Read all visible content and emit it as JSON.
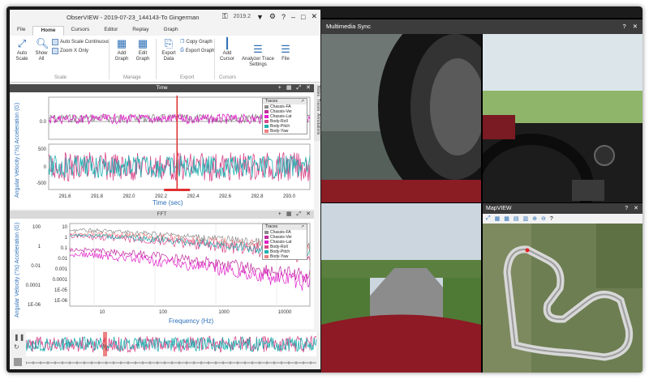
{
  "app": {
    "title": "ObserVIEW - 2019-07-23_144143-To Gingerman",
    "version": "2019.2",
    "menu_tabs": [
      "File",
      "Home",
      "Cursors",
      "Editor",
      "Replay",
      "Graph"
    ],
    "active_tab": "Home"
  },
  "ribbon": {
    "auto_scale": "Auto Scale",
    "show_all": "Show All",
    "auto_scale_continuous": "Auto Scale Continuous",
    "zoom_x_only": "Zoom X Only",
    "add_graph": "Add Graph",
    "edit_graph": "Edit Graph",
    "export_data": "Export Data",
    "copy_graph": "Copy Graph",
    "export_graph": "Export Graph",
    "add_cursor": "Add Cursor",
    "analyzer_trace_settings": "Analyzer Trace Settings",
    "file": "File",
    "groups": {
      "scale": "Scale",
      "manage": "Manage",
      "export": "Export",
      "cursors": "Cursors"
    }
  },
  "time_panel": {
    "title": "Time",
    "ylabel": "Angular Velocity (°/s) Acceleration (G)",
    "xlabel": "Time (sec)",
    "side_tabs": [
      "Notes",
      "Traces",
      "Annotations"
    ],
    "legend_title": "Traces",
    "traces": [
      {
        "name": "Chassis-FA",
        "color": "#8a8a8a"
      },
      {
        "name": "Chassis-Ver",
        "color": "#c02b9e"
      },
      {
        "name": "Chassis-Lat",
        "color": "#e01fc8"
      },
      {
        "name": "Body-Roll",
        "color": "#d9478a"
      },
      {
        "name": "Body-Pitch",
        "color": "#20b0b0"
      },
      {
        "name": "Body-Yaw",
        "color": "#f07f7f"
      }
    ]
  },
  "fft_panel": {
    "title": "FFT",
    "ylabel": "Angular Velocity (°/s) Acceleration (G)",
    "xlabel": "Frequency (Hz)",
    "legend_title": "Traces",
    "traces": [
      {
        "name": "Chassis-FA",
        "color": "#8a8a8a"
      },
      {
        "name": "Chassis-Ver",
        "color": "#c02b9e"
      },
      {
        "name": "Chassis-Lat",
        "color": "#e01fc8"
      },
      {
        "name": "Body-Roll",
        "color": "#d9478a"
      },
      {
        "name": "Body-Pitch",
        "color": "#20b0b0"
      },
      {
        "name": "Body-Yaw",
        "color": "#f07f7f"
      }
    ]
  },
  "multimedia": {
    "title": "Multimedia Sync"
  },
  "mapview": {
    "title": "MapVIEW"
  },
  "chart_data": [
    {
      "type": "line",
      "title": "Time",
      "xlabel": "Time (sec)",
      "ylabel": "Angular Velocity (°/s) Acceleration (G)",
      "x_ticks": [
        "291.6",
        "291.8",
        "292.0",
        "292.2",
        "292.4",
        "292.6",
        "292.8",
        "293.0",
        "293.2"
      ],
      "y_ticks_top": [
        "0.0"
      ],
      "y_ticks_bottom": [
        "500",
        "0",
        "-500"
      ],
      "cursor_x": 292.3,
      "series": [
        {
          "name": "Chassis-FA",
          "values": [
            0.05,
            0.03,
            0.06,
            0.04,
            0.05,
            0.07,
            0.04,
            0.05,
            0.06
          ]
        },
        {
          "name": "Chassis-Lat",
          "values": [
            0.0,
            0.02,
            -0.01,
            0.03,
            0.0,
            0.01,
            -0.02,
            0.02,
            0.0
          ]
        },
        {
          "name": "Body-Pitch",
          "values": [
            120,
            -150,
            200,
            -100,
            150,
            -180,
            130,
            -120,
            100
          ]
        },
        {
          "name": "Body-Roll",
          "values": [
            60,
            -80,
            100,
            -60,
            80,
            -90,
            70,
            -70,
            60
          ]
        }
      ]
    },
    {
      "type": "line",
      "title": "FFT",
      "xlabel": "Frequency (Hz)",
      "ylabel": "Angular Velocity (°/s) Acceleration (G)",
      "x_ticks": [
        "10",
        "100",
        "1000",
        "10000"
      ],
      "y_ticks_left": [
        "100",
        "1",
        "0.01",
        "0.0001",
        "1E-06"
      ],
      "y_ticks_right": [
        "10",
        "1",
        "0.1",
        "0.01",
        "0.001",
        "0.0001",
        "1E-05",
        "1E-06"
      ],
      "log_x": true,
      "log_y": true
    }
  ]
}
